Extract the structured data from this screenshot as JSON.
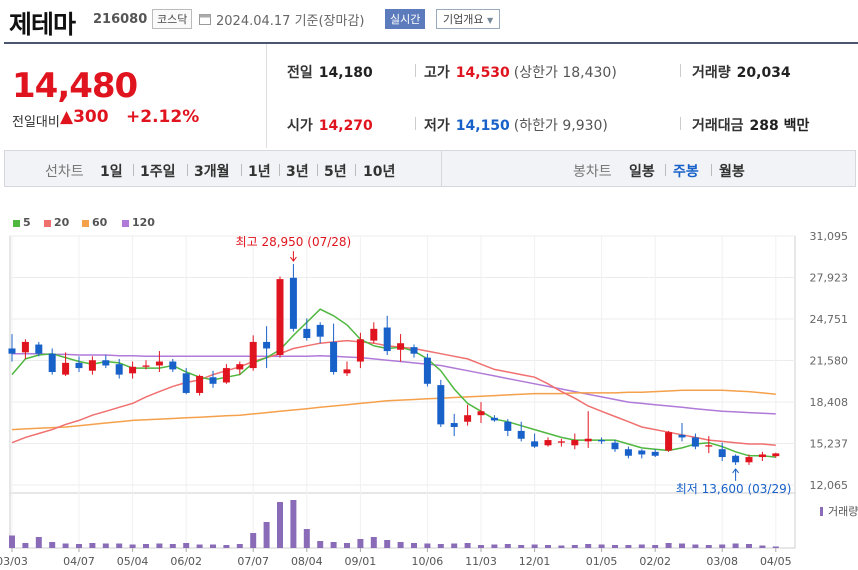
{
  "header": {
    "name": "제테마",
    "code": "216080",
    "market": "코스닥",
    "date_text": "2024.04.17 기준(장마감)",
    "realtime_label": "실시간",
    "company_label": "기업개요"
  },
  "price": {
    "current": "14,480",
    "change_label": "전일대비",
    "change": "300",
    "change_pct": "+2.12%"
  },
  "stats": {
    "prev_label": "전일",
    "prev": "14,180",
    "high_label": "고가",
    "high": "14,530",
    "upper_limit": "(상한가 18,430)",
    "volume_label": "거래량",
    "volume": "20,034",
    "open_label": "시가",
    "open": "14,270",
    "low_label": "저가",
    "low": "14,150",
    "lower_limit": "(하한가 9,930)",
    "amount_label": "거래대금",
    "amount": "288 백만"
  },
  "tabs": {
    "line_label": "선차트",
    "line_items": [
      "1일",
      "1주일",
      "3개월",
      "1년",
      "3년",
      "5년",
      "10년"
    ],
    "candle_label": "봉차트",
    "candle_items": [
      "일봉",
      "주봉",
      "월봉"
    ]
  },
  "colors": {
    "up": "#e0141e",
    "down": "#1861c8",
    "ma5": "#4fb73f",
    "ma20": "#f07070",
    "ma60": "#f5a04a",
    "ma120": "#b07ad8",
    "volume": "#8a6bb8"
  },
  "chart_data": {
    "type": "candlestick",
    "legend": [
      {
        "name": "5",
        "color": "#4fb73f"
      },
      {
        "name": "20",
        "color": "#f07070"
      },
      {
        "name": "60",
        "color": "#f5a04a"
      },
      {
        "name": "120",
        "color": "#b07ad8"
      }
    ],
    "y_ticks": [
      12065,
      15237,
      18408,
      21580,
      24751,
      27923,
      31095
    ],
    "y_tick_labels": [
      "12,065",
      "15,237",
      "18,408",
      "21,580",
      "24,751",
      "27,923",
      "31,095"
    ],
    "ylim": [
      12065,
      31095
    ],
    "x_labels": [
      "03/03",
      "04/07",
      "05/04",
      "06/02",
      "07/07",
      "08/04",
      "09/01",
      "10/06",
      "11/03",
      "12/01",
      "01/05",
      "02/02",
      "03/08",
      "04/05"
    ],
    "x_label_index": [
      0,
      5,
      9,
      13,
      18,
      22,
      26,
      31,
      35,
      39,
      44,
      48,
      53,
      57
    ],
    "annotations": {
      "high": "최고 28,950 (07/28)",
      "low": "최저 13,600 (03/29)"
    },
    "volume_label": "거래량",
    "candles": [
      [
        22500,
        23600,
        21500,
        22100
      ],
      [
        22200,
        23200,
        21700,
        23000
      ],
      [
        22800,
        23000,
        21900,
        22100
      ],
      [
        22100,
        22500,
        20500,
        20700
      ],
      [
        20500,
        22200,
        20400,
        21400
      ],
      [
        21400,
        21900,
        20700,
        21000
      ],
      [
        20800,
        21900,
        20500,
        21600
      ],
      [
        21600,
        22000,
        21000,
        21200
      ],
      [
        21300,
        21700,
        20200,
        20500
      ],
      [
        20600,
        21500,
        20200,
        21100
      ],
      [
        21100,
        21600,
        20900,
        21200
      ],
      [
        21200,
        22300,
        20700,
        21500
      ],
      [
        21500,
        21700,
        20700,
        20900
      ],
      [
        20600,
        21000,
        19000,
        19100
      ],
      [
        19100,
        20500,
        18900,
        20400
      ],
      [
        20300,
        20800,
        19500,
        19800
      ],
      [
        19900,
        21300,
        19800,
        21000
      ],
      [
        20900,
        21500,
        20500,
        21300
      ],
      [
        21000,
        23500,
        20800,
        23000
      ],
      [
        23000,
        24200,
        21000,
        22500
      ],
      [
        22000,
        28000,
        21800,
        27800
      ],
      [
        27900,
        28950,
        23800,
        24000
      ],
      [
        24000,
        24800,
        23100,
        23300
      ],
      [
        24300,
        24500,
        22900,
        23400
      ],
      [
        23000,
        24400,
        20500,
        20700
      ],
      [
        20600,
        21500,
        20400,
        20900
      ],
      [
        21500,
        23700,
        21000,
        23200
      ],
      [
        23100,
        24500,
        22900,
        24000
      ],
      [
        24100,
        25000,
        22000,
        22300
      ],
      [
        22400,
        23600,
        21500,
        22900
      ],
      [
        22600,
        22800,
        21800,
        22100
      ],
      [
        21800,
        22100,
        19600,
        19800
      ],
      [
        19700,
        20100,
        16500,
        16700
      ],
      [
        16800,
        17500,
        15800,
        16500
      ],
      [
        16900,
        18200,
        16600,
        17400
      ],
      [
        17400,
        18400,
        16800,
        17700
      ],
      [
        17200,
        17400,
        16900,
        17000
      ],
      [
        16900,
        17100,
        15800,
        16200
      ],
      [
        16200,
        16900,
        15400,
        15600
      ],
      [
        15400,
        16000,
        14900,
        15000
      ],
      [
        15100,
        15700,
        15000,
        15500
      ],
      [
        15300,
        15600,
        15000,
        15400
      ],
      [
        15100,
        16000,
        14800,
        15500
      ],
      [
        15400,
        17700,
        14900,
        15600
      ],
      [
        15500,
        15700,
        15200,
        15400
      ],
      [
        15300,
        15500,
        14600,
        14800
      ],
      [
        14800,
        15000,
        14100,
        14300
      ],
      [
        14700,
        14800,
        14100,
        14400
      ],
      [
        14600,
        14800,
        14200,
        14300
      ],
      [
        14700,
        16200,
        14600,
        16100
      ],
      [
        15900,
        16800,
        15400,
        15700
      ],
      [
        15700,
        16000,
        14800,
        15000
      ],
      [
        15000,
        15800,
        14500,
        15100
      ],
      [
        14800,
        15300,
        13900,
        14200
      ],
      [
        14300,
        14400,
        13600,
        13800
      ],
      [
        13800,
        14400,
        13600,
        14200
      ],
      [
        14200,
        14600,
        13900,
        14400
      ],
      [
        14270,
        14530,
        14150,
        14480
      ]
    ],
    "ma5": [
      20500,
      21700,
      22000,
      22100,
      21800,
      21500,
      21300,
      21500,
      21400,
      21000,
      21000,
      21000,
      21200,
      20700,
      20300,
      20100,
      20300,
      20500,
      21400,
      21800,
      22400,
      23500,
      24500,
      25500,
      25000,
      24300,
      23200,
      22700,
      22500,
      22600,
      22300,
      21700,
      20800,
      19400,
      18300,
      17700,
      17100,
      16900,
      16600,
      16300,
      16000,
      15700,
      15500,
      15500,
      15500,
      15500,
      15200,
      14900,
      14800,
      14700,
      14900,
      15200,
      15300,
      15000,
      14600,
      14300,
      14300,
      14200
    ],
    "ma20": [
      15300,
      15700,
      16000,
      16300,
      16700,
      17000,
      17400,
      17700,
      18000,
      18300,
      18800,
      19200,
      19600,
      19900,
      20100,
      20500,
      20800,
      21100,
      21500,
      21800,
      22100,
      22500,
      22700,
      22900,
      23000,
      23100,
      23000,
      22900,
      22700,
      22600,
      22500,
      22300,
      22100,
      21900,
      21700,
      21300,
      20900,
      20700,
      20500,
      20300,
      19800,
      19200,
      18700,
      18100,
      17700,
      17300,
      16900,
      16500,
      16300,
      16100,
      15900,
      15700,
      15500,
      15400,
      15300,
      15200,
      15200,
      15100
    ],
    "ma60": [
      16300,
      16350,
      16400,
      16450,
      16500,
      16600,
      16700,
      16800,
      16900,
      17000,
      17050,
      17100,
      17150,
      17200,
      17250,
      17300,
      17350,
      17400,
      17500,
      17600,
      17700,
      17800,
      17900,
      18000,
      18100,
      18200,
      18300,
      18400,
      18500,
      18550,
      18600,
      18650,
      18700,
      18750,
      18800,
      18850,
      18900,
      18950,
      19000,
      19050,
      19050,
      19050,
      19100,
      19100,
      19100,
      19100,
      19150,
      19150,
      19200,
      19250,
      19300,
      19300,
      19300,
      19300,
      19250,
      19200,
      19100,
      19000
    ],
    "ma120": [
      22100,
      22100,
      22100,
      22050,
      22050,
      22000,
      22000,
      22000,
      21950,
      21950,
      21900,
      21900,
      21900,
      21900,
      21900,
      21900,
      21900,
      21900,
      21900,
      21900,
      21900,
      21900,
      21900,
      21950,
      21900,
      21850,
      21800,
      21700,
      21600,
      21500,
      21400,
      21300,
      21200,
      21000,
      20800,
      20600,
      20400,
      20200,
      20000,
      19800,
      19600,
      19400,
      19200,
      19000,
      18800,
      18600,
      18400,
      18300,
      18200,
      18100,
      18000,
      17900,
      17800,
      17700,
      17650,
      17600,
      17550,
      17500
    ],
    "volume": [
      25,
      10,
      22,
      12,
      9,
      8,
      10,
      9,
      9,
      7,
      8,
      9,
      8,
      10,
      7,
      7,
      6,
      8,
      30,
      52,
      92,
      96,
      38,
      14,
      12,
      10,
      18,
      22,
      16,
      12,
      10,
      9,
      8,
      9,
      10,
      6,
      7,
      8,
      6,
      7,
      6,
      5,
      6,
      8,
      7,
      6,
      6,
      7,
      6,
      10,
      9,
      7,
      6,
      7,
      9,
      8,
      5,
      3
    ]
  }
}
